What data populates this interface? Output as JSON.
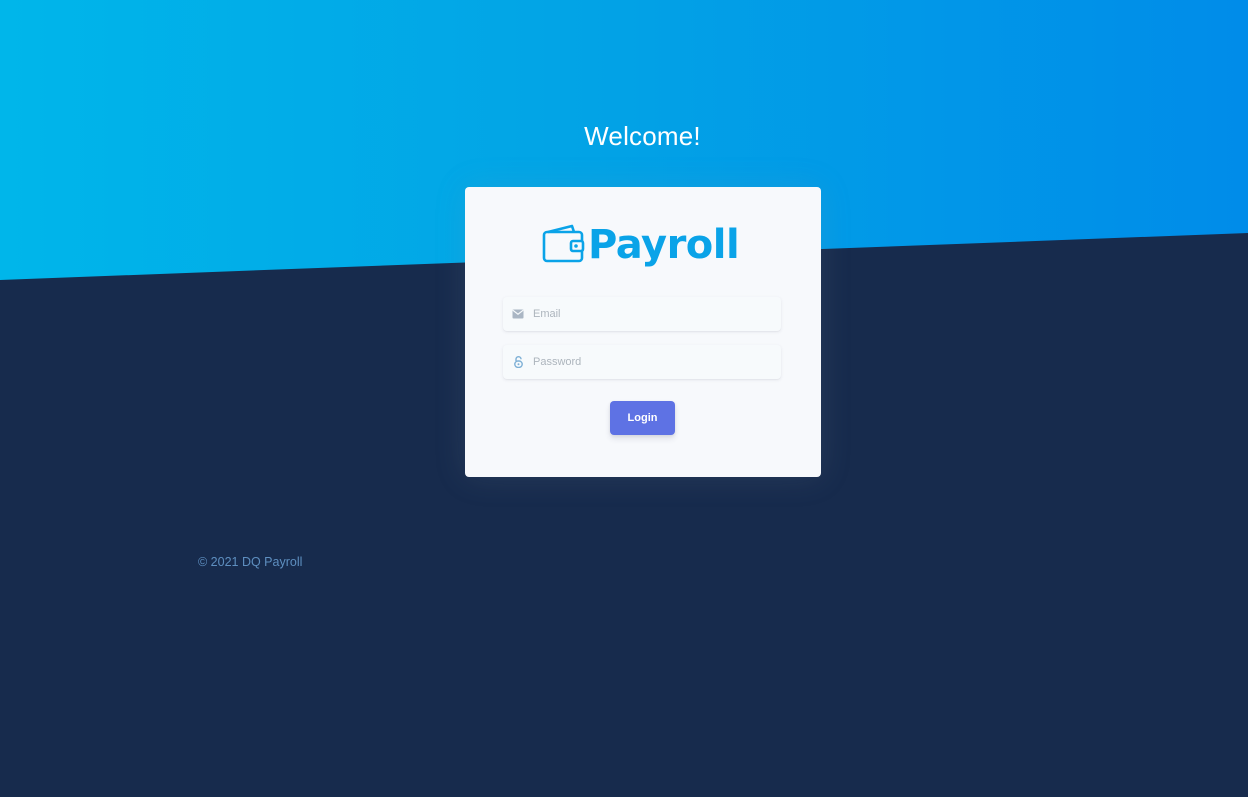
{
  "page": {
    "heading": "Welcome!",
    "footer": "© 2021 DQ Payroll"
  },
  "logo": {
    "icon": "wallet-icon",
    "text": "Payroll",
    "color": "#0aa3e8"
  },
  "form": {
    "email": {
      "icon": "envelope-icon",
      "placeholder": "Email",
      "value": ""
    },
    "password": {
      "icon": "lock-icon",
      "placeholder": "Password",
      "value": ""
    },
    "submit_label": "Login"
  },
  "colors": {
    "header_gradient_start": "#00b6ea",
    "header_gradient_end": "#008ce9",
    "background": "#172b4d",
    "card": "#f7f9fc",
    "button": "#5e72e4",
    "footer_text": "#5e8fc0"
  }
}
